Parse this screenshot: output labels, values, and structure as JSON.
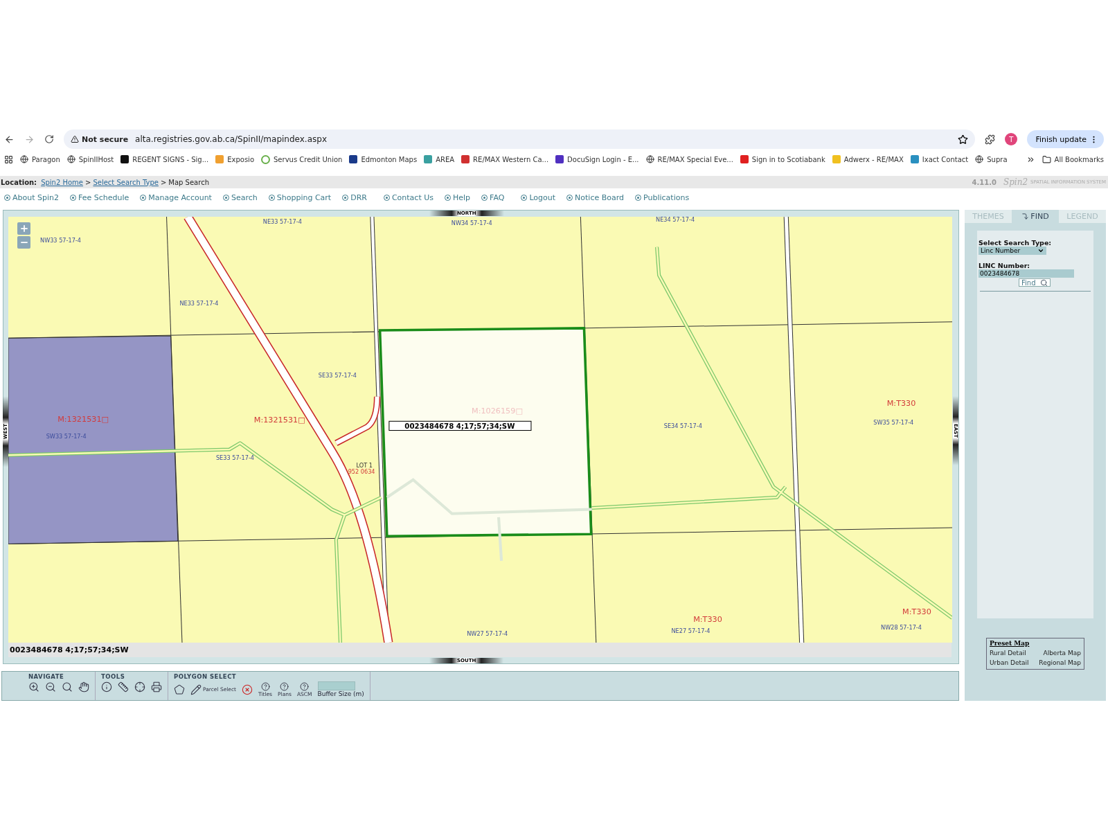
{
  "browser": {
    "security": "Not secure",
    "url": "alta.registries.gov.ab.ca/SpinII/mapindex.aspx",
    "profile_initial": "T",
    "update_button": "Finish update"
  },
  "bookmarks": [
    "Paragon",
    "SpinIIHost",
    "REGENT SIGNS - Sig...",
    "Exposio",
    "Servus Credit Union",
    "Edmonton  Maps",
    "AREA",
    "RE/MAX Western Ca...",
    "DocuSign Login - E...",
    "RE/MAX Special Eve...",
    "Sign in to Scotiabank",
    "Adwerx - RE/MAX",
    "Ixact Contact",
    "Supra"
  ],
  "all_bookmarks": "All Bookmarks",
  "location": {
    "label": "Location:",
    "separator": ">",
    "crumbs": [
      {
        "text": "Spin2 Home",
        "link": true
      },
      {
        "text": "Select Search Type",
        "link": true
      },
      {
        "text": "Map Search",
        "link": false
      }
    ]
  },
  "version": "4.11.0",
  "logo": "Spin2",
  "tagline": "SPATIAL INFORMATION SYSTEM",
  "menu": [
    "About Spin2",
    "Fee Schedule",
    "Manage Account",
    "Search",
    "Shopping Cart",
    "DRR",
    "Contact Us",
    "Help",
    "FAQ",
    "Logout",
    "Notice Board",
    "Publications"
  ],
  "map": {
    "compass": {
      "north": "NORTH",
      "south": "SOUTH",
      "west": "WEST",
      "east": "EAST"
    },
    "labels": [
      {
        "text": "NW33 57-17-4",
        "kind": "section"
      },
      {
        "text": "NE33 57-17-4",
        "kind": "section"
      },
      {
        "text": "NW34 57-17-4",
        "kind": "section"
      },
      {
        "text": "NE34 57-17-4",
        "kind": "section"
      },
      {
        "text": "NE33 57-17-4",
        "kind": "section"
      },
      {
        "text": "SE33 57-17-4",
        "kind": "section"
      },
      {
        "text": "M:1321531□",
        "kind": "title"
      },
      {
        "text": "SW33 57-17-4",
        "kind": "section"
      },
      {
        "text": "M:1321531□",
        "kind": "title"
      },
      {
        "text": "SE33 57-17-4",
        "kind": "section"
      },
      {
        "text": "LOT 1",
        "kind": "lot"
      },
      {
        "text": "952 0634",
        "kind": "plan"
      },
      {
        "text": "M:1026159□",
        "kind": "faint"
      },
      {
        "text": "SE34 57-17-4",
        "kind": "section"
      },
      {
        "text": "M:T330",
        "kind": "title"
      },
      {
        "text": "SW35 57-17-4",
        "kind": "section"
      },
      {
        "text": "NW27 57-17-4",
        "kind": "section"
      },
      {
        "text": "M:T330",
        "kind": "title"
      },
      {
        "text": "NE27 57-17-4",
        "kind": "section"
      },
      {
        "text": "M:T330",
        "kind": "title"
      },
      {
        "text": "NW28 57-17-4",
        "kind": "section"
      }
    ],
    "selected_label": "0023484678 4;17;57;34;SW",
    "status": "0023484678 4;17;57;34;SW"
  },
  "toolbar": [
    {
      "title": "NAVIGATE",
      "tools": [
        {
          "kind": "zoom-in"
        },
        {
          "kind": "zoom-out"
        },
        {
          "kind": "zoom-extent"
        },
        {
          "kind": "pan"
        }
      ]
    },
    {
      "title": "TOOLS",
      "tools": [
        {
          "kind": "info"
        },
        {
          "kind": "measure"
        },
        {
          "kind": "locate"
        },
        {
          "kind": "print"
        }
      ]
    },
    {
      "title": "POLYGON SELECT",
      "tools": [
        {
          "kind": "polygon"
        },
        {
          "kind": "parcel",
          "label": "Parcel Select"
        },
        {
          "kind": "clear"
        },
        {
          "kind": "help",
          "label": "Titles"
        },
        {
          "kind": "help",
          "label": "Plans"
        },
        {
          "kind": "help",
          "label": "ASCM"
        },
        {
          "kind": "buffer",
          "label": "Buffer Size (m)"
        }
      ]
    }
  ],
  "panel": {
    "tabs": [
      {
        "label": "THEMES",
        "selected": false
      },
      {
        "label": "FIND",
        "selected": true
      },
      {
        "label": "LEGEND",
        "selected": false
      }
    ],
    "search_type_label": "Select Search Type:",
    "search_type": "Linc Number",
    "linc_label": "LINC Number:",
    "linc_value": "0023484678",
    "find_button": "Find",
    "preset": {
      "title": "Preset Map",
      "links": [
        "Rural Detail",
        "Alberta Map",
        "Urban Detail",
        "Regional Map"
      ]
    }
  }
}
